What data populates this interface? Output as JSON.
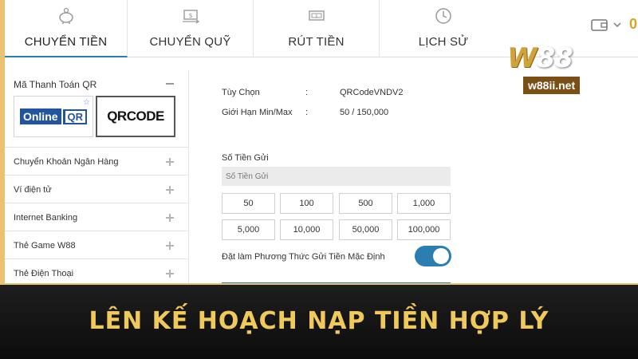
{
  "tabs": [
    {
      "label": "CHUYỂN TIỀN",
      "icon": "piggy-bank-icon",
      "active": true
    },
    {
      "label": "CHUYỂN QUỸ",
      "icon": "transfer-money-icon",
      "active": false
    },
    {
      "label": "RÚT TIỀN",
      "icon": "withdraw-cash-icon",
      "active": false
    },
    {
      "label": "LỊCH SỬ",
      "icon": "clock-history-icon",
      "active": false
    }
  ],
  "header": {
    "balance_digit": "0",
    "wallet_icon": "wallet-icon",
    "chevron_icon": "chevron-down-icon"
  },
  "logo": {
    "mark_w": "W",
    "mark_num": "88",
    "url": "w88ii.net"
  },
  "sidebar": {
    "section_label": "Mã Thanh Toán QR",
    "qr_options": [
      {
        "part1": "Online",
        "part2": "QR"
      },
      {
        "label": "QRCODE"
      }
    ],
    "items": [
      {
        "label": "Chuyển Khoản Ngân Hàng"
      },
      {
        "label": "Ví điện tử"
      },
      {
        "label": "Internet Banking"
      },
      {
        "label": "Thẻ Game W88"
      },
      {
        "label": "Thẻ Điện Thoại"
      }
    ]
  },
  "form": {
    "option_key": "Tùy Chọn",
    "option_value": "QRCodeVNDV2",
    "limit_key": "Giới Hạn Min/Max",
    "limit_value": "50 / 150,000",
    "separator": ":",
    "amount_label": "Số Tiền Gửi",
    "amount_placeholder": "Số Tiền Gửi",
    "amounts": [
      "50",
      "100",
      "500",
      "1,000",
      "5,000",
      "10,000",
      "50,000",
      "100,000"
    ],
    "default_label": "Đặt làm Phương Thức Gửi Tiền Mặc Định",
    "default_on": true
  },
  "banner": {
    "text": "LÊN KẾ HOẠCH NẠP TIỀN HỢP LÝ"
  },
  "colors": {
    "accent": "#2b7fb0",
    "gold": "#f0c95c",
    "banner_bg": "#111111"
  }
}
